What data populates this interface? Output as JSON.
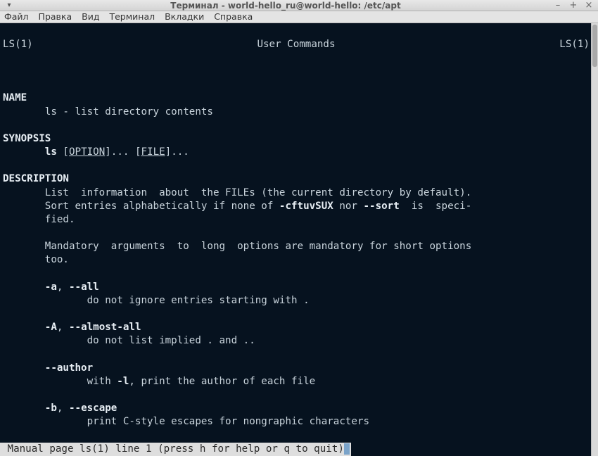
{
  "window": {
    "title": "Терминал - world-hello_ru@world-hello: /etc/apt"
  },
  "menu": {
    "file": "Файл",
    "edit": "Правка",
    "view": "Вид",
    "terminal": "Терминал",
    "tabs": "Вкладки",
    "help": "Справка"
  },
  "man": {
    "header_left": "LS(1)",
    "header_center": "User Commands",
    "header_right": "LS(1)",
    "sec_name": "NAME",
    "name_line": "       ls - list directory contents",
    "sec_synopsis": "SYNOPSIS",
    "syn_prefix": "       ",
    "syn_cmd": "ls",
    "syn_space1": " [",
    "syn_option": "OPTION",
    "syn_mid": "]... [",
    "syn_file": "FILE",
    "syn_end": "]...",
    "sec_description": "DESCRIPTION",
    "desc_l1": "       List  information  about  the FILEs (the current directory by default).",
    "desc_l2a": "       Sort entries alphabetically if none of ",
    "desc_l2b": "-cftuvSUX",
    "desc_l2c": " nor ",
    "desc_l2d": "--sort",
    "desc_l2e": "  is  speci‐",
    "desc_l3": "       fied.",
    "desc_l4": "       Mandatory  arguments  to  long  options are mandatory for short options",
    "desc_l5": "       too.",
    "opt_a_pre": "       ",
    "opt_a_short": "-a",
    "opt_a_sep": ", ",
    "opt_a_long": "--all",
    "opt_a_desc": "              do not ignore entries starting with .",
    "opt_A_pre": "       ",
    "opt_A_short": "-A",
    "opt_A_sep": ", ",
    "opt_A_long": "--almost-all",
    "opt_A_desc": "              do not list implied . and ..",
    "opt_author_pre": "       ",
    "opt_author_long": "--author",
    "opt_author_desc_a": "              with ",
    "opt_author_desc_b": "-l",
    "opt_author_desc_c": ", print the author of each file",
    "opt_b_pre": "       ",
    "opt_b_short": "-b",
    "opt_b_sep": ", ",
    "opt_b_long": "--escape",
    "opt_b_desc": "              print C-style escapes for nongraphic characters",
    "status_line": " Manual page ls(1) line 1 (press h for help or q to quit)",
    "status_cursor": " "
  }
}
